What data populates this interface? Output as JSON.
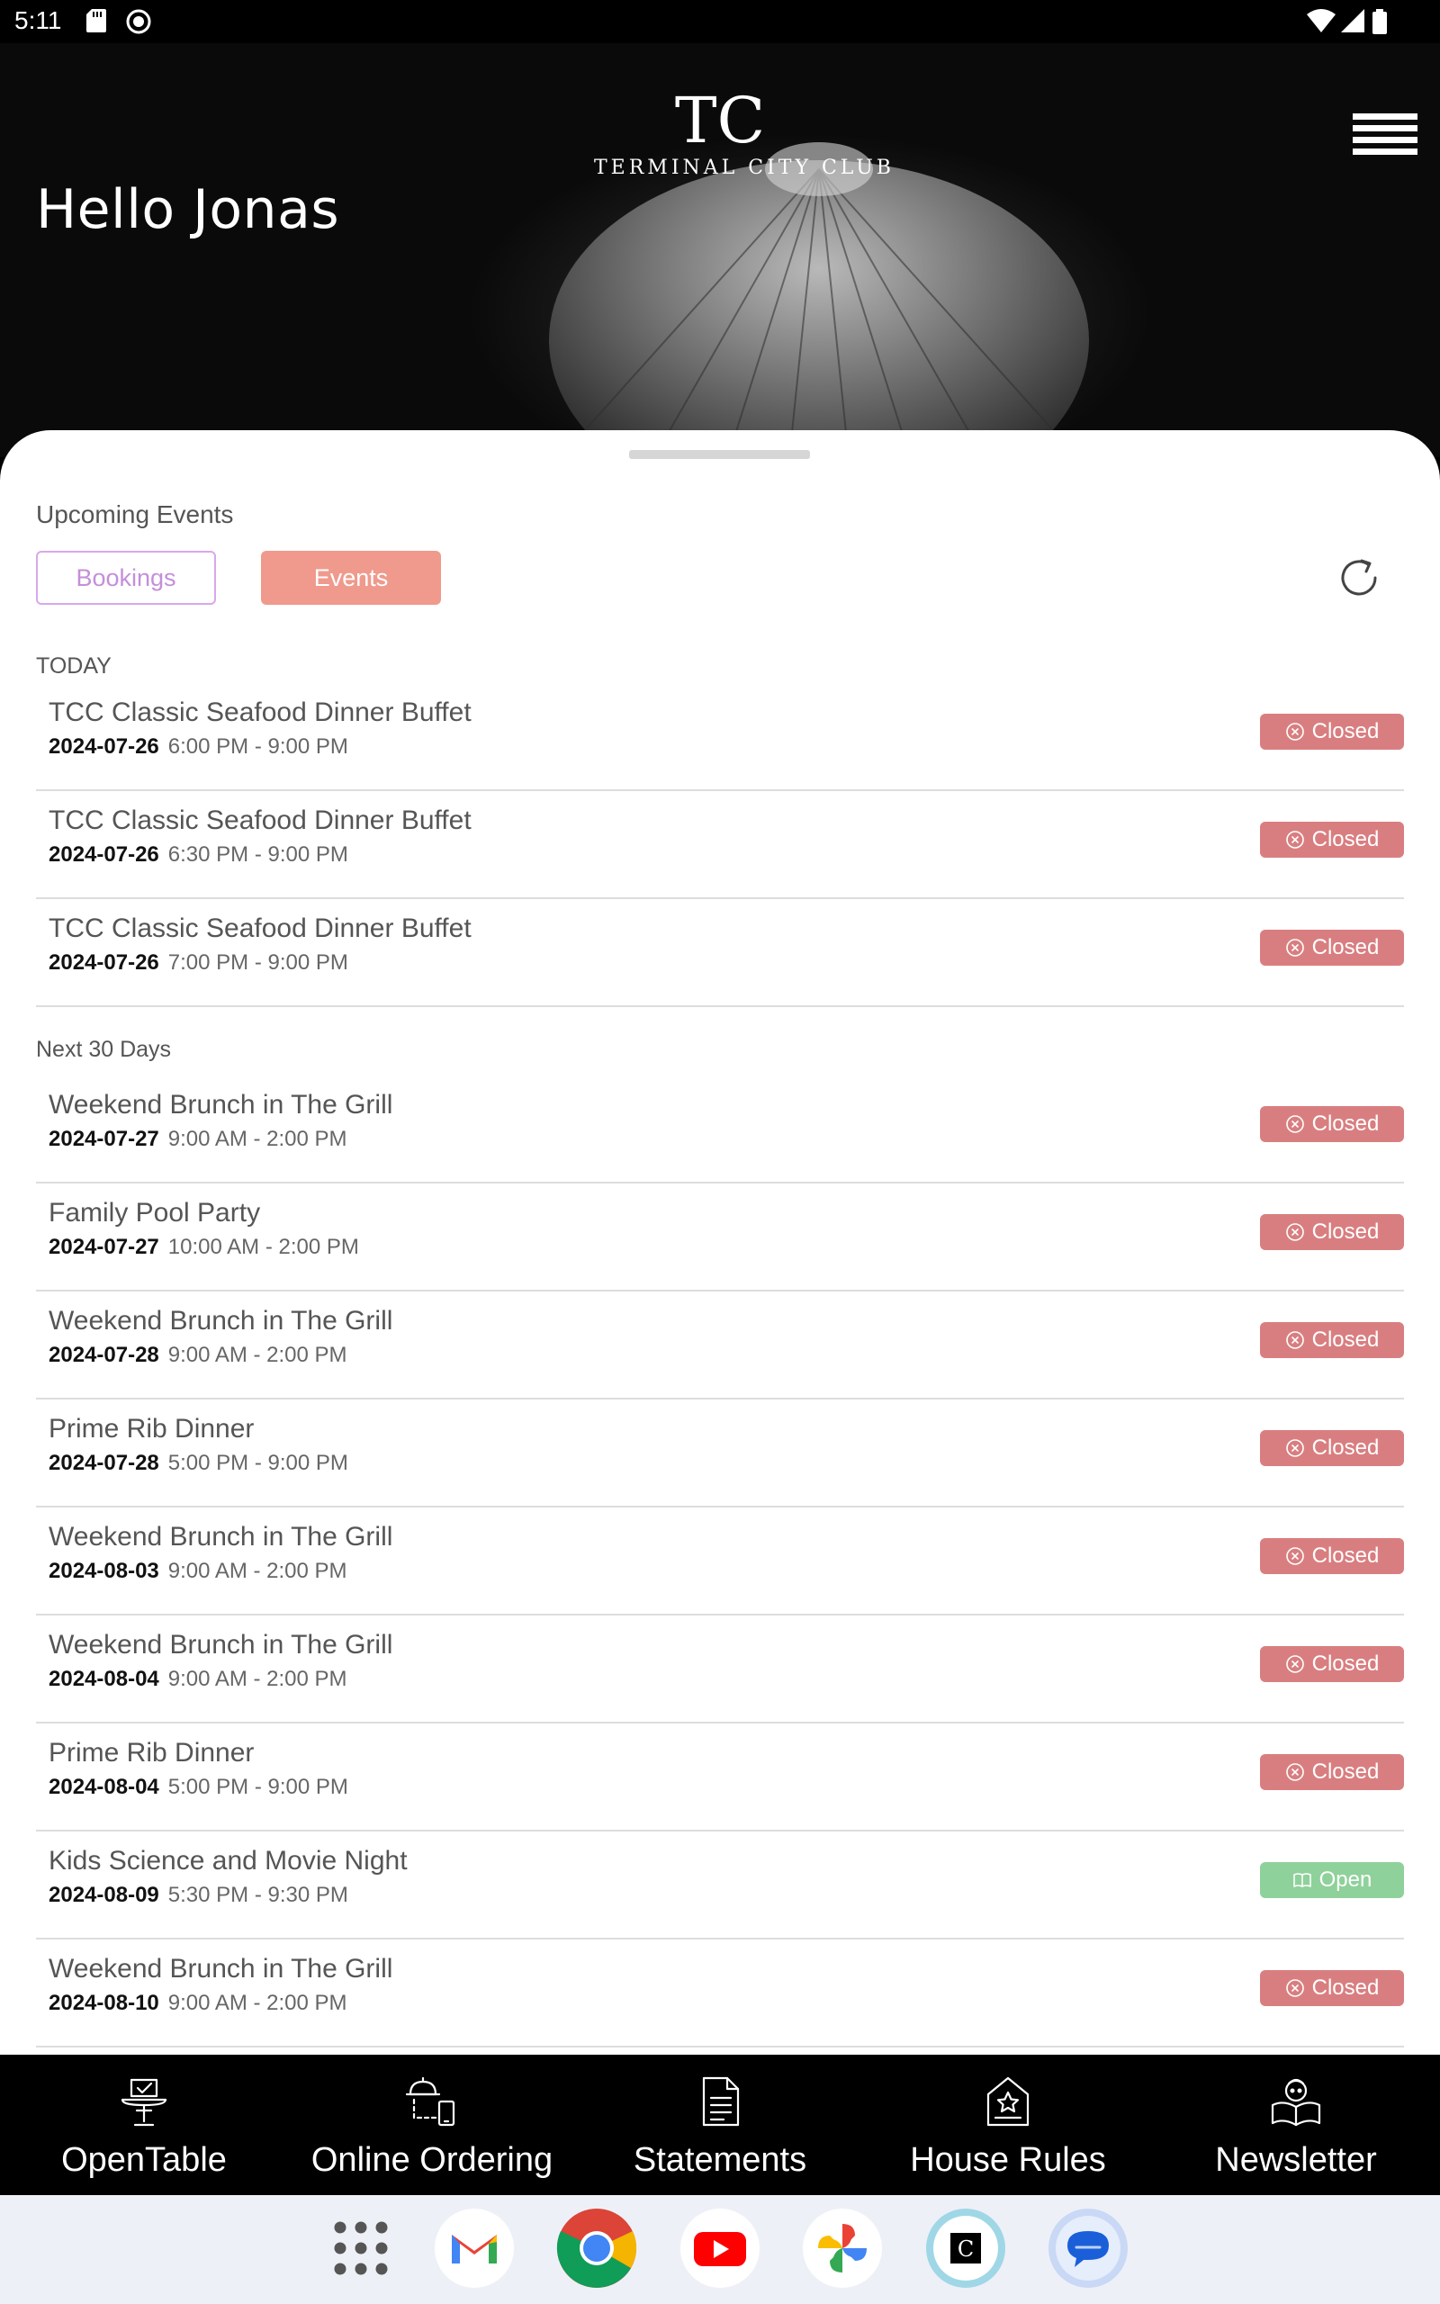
{
  "status_bar": {
    "time": "5:11"
  },
  "header": {
    "greeting": "Hello Jonas",
    "logo_text": "TERMINAL CITY CLUB",
    "logo_mark": "TC"
  },
  "events_panel": {
    "title": "Upcoming Events",
    "tabs": [
      {
        "label": "Bookings",
        "active": false
      },
      {
        "label": "Events",
        "active": true
      }
    ],
    "groups": [
      {
        "label": "TODAY",
        "events": [
          {
            "title": "TCC Classic Seafood Dinner Buffet",
            "date": "2024-07-26",
            "time": "6:00 PM - 9:00 PM",
            "status": "Closed"
          },
          {
            "title": "TCC Classic Seafood Dinner Buffet",
            "date": "2024-07-26",
            "time": "6:30 PM - 9:00 PM",
            "status": "Closed"
          },
          {
            "title": "TCC Classic Seafood Dinner Buffet",
            "date": "2024-07-26",
            "time": "7:00 PM - 9:00 PM",
            "status": "Closed"
          }
        ]
      },
      {
        "label": "Next 30 Days",
        "events": [
          {
            "title": "Weekend Brunch in The Grill",
            "date": "2024-07-27",
            "time": "9:00 AM - 2:00 PM",
            "status": "Closed"
          },
          {
            "title": "Family Pool Party",
            "date": "2024-07-27",
            "time": "10:00 AM - 2:00 PM",
            "status": "Closed"
          },
          {
            "title": "Weekend Brunch in The Grill",
            "date": "2024-07-28",
            "time": "9:00 AM - 2:00 PM",
            "status": "Closed"
          },
          {
            "title": "Prime Rib Dinner",
            "date": "2024-07-28",
            "time": "5:00 PM - 9:00 PM",
            "status": "Closed"
          },
          {
            "title": "Weekend Brunch in The Grill",
            "date": "2024-08-03",
            "time": "9:00 AM - 2:00 PM",
            "status": "Closed"
          },
          {
            "title": "Weekend Brunch in The Grill",
            "date": "2024-08-04",
            "time": "9:00 AM - 2:00 PM",
            "status": "Closed"
          },
          {
            "title": "Prime Rib Dinner",
            "date": "2024-08-04",
            "time": "5:00 PM - 9:00 PM",
            "status": "Closed"
          },
          {
            "title": "Kids Science and Movie Night",
            "date": "2024-08-09",
            "time": "5:30 PM - 9:30 PM",
            "status": "Open"
          },
          {
            "title": "Weekend Brunch in The Grill",
            "date": "2024-08-10",
            "time": "9:00 AM - 2:00 PM",
            "status": "Closed"
          }
        ]
      }
    ]
  },
  "bottom_nav": [
    {
      "label": "OpenTable",
      "icon": "opentable-icon"
    },
    {
      "label": "Online Ordering",
      "icon": "online-ordering-icon"
    },
    {
      "label": "Statements",
      "icon": "statements-icon"
    },
    {
      "label": "House Rules",
      "icon": "house-rules-icon"
    },
    {
      "label": "Newsletter",
      "icon": "newsletter-icon"
    }
  ],
  "dock": [
    {
      "name": "app-drawer",
      "icon": "apps-grid-icon"
    },
    {
      "name": "gmail",
      "icon": "gmail-icon"
    },
    {
      "name": "chrome",
      "icon": "chrome-icon"
    },
    {
      "name": "youtube",
      "icon": "youtube-icon"
    },
    {
      "name": "photos",
      "icon": "photos-icon"
    },
    {
      "name": "terminal-city-club",
      "icon": "tcc-app-icon"
    },
    {
      "name": "messages",
      "icon": "messages-icon"
    }
  ],
  "colors": {
    "closed": "#d97e80",
    "open": "#8fd19a",
    "events_tab": "#ef9a8c",
    "bookings_tab_border": "#d9a8ea"
  }
}
